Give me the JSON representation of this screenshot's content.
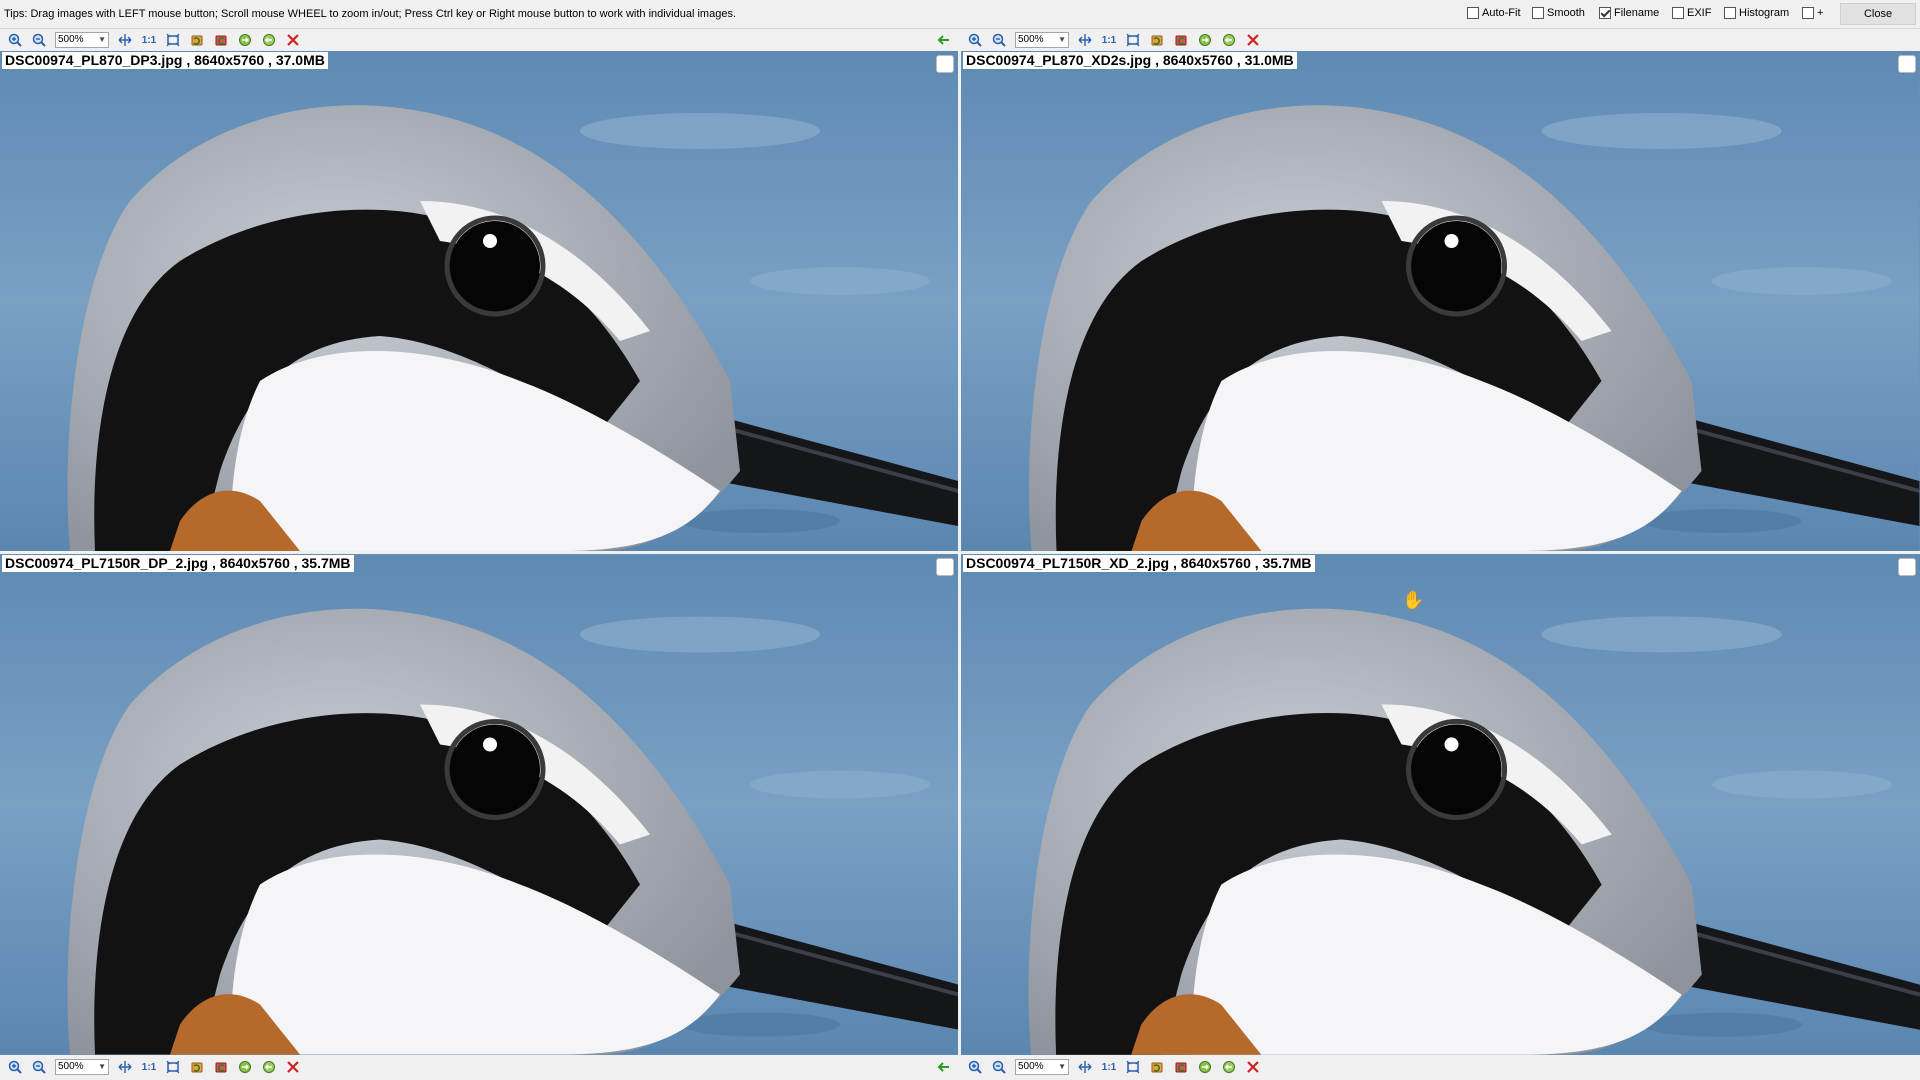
{
  "tips": "Tips: Drag images with LEFT mouse button; Scroll mouse WHEEL to zoom in/out; Press Ctrl key or Right mouse button to work with individual images.",
  "options": [
    {
      "label": "Auto-Fit",
      "checked": false
    },
    {
      "label": "Smooth",
      "checked": false
    },
    {
      "label": "Filename",
      "checked": true
    },
    {
      "label": "EXIF",
      "checked": false
    },
    {
      "label": "Histogram",
      "checked": false
    },
    {
      "label": "+",
      "checked": false
    }
  ],
  "close_label": "Close",
  "toolbar": {
    "zoom": "500%",
    "one_to_one": "1:1",
    "icons": [
      "zoom-in-icon",
      "zoom-out-icon",
      "fit-icon",
      "one-to-one-icon",
      "fit-window-icon",
      "rotate-left-icon",
      "rotate-right-icon",
      "flip-icon",
      "sync-icon",
      "remove-icon",
      "sync-arrow-icon"
    ]
  },
  "images": [
    {
      "caption": "DSC00974_PL870_DP3.jpg , 8640x5760 , 37.0MB"
    },
    {
      "caption": "DSC00974_PL870_XD2s.jpg , 8640x5760 , 31.0MB"
    },
    {
      "caption": "DSC00974_PL7150R_DP_2.jpg , 8640x5760 , 35.7MB"
    },
    {
      "caption": "DSC00974_PL7150R_XD_2.jpg , 8640x5760 , 35.7MB"
    }
  ],
  "colors": {
    "background": "#f0f0f0",
    "water": "#6b93b8",
    "accent_blue": "#2a5fae",
    "remove_red": "#d02020",
    "arrow_green": "#2d9a2d"
  }
}
